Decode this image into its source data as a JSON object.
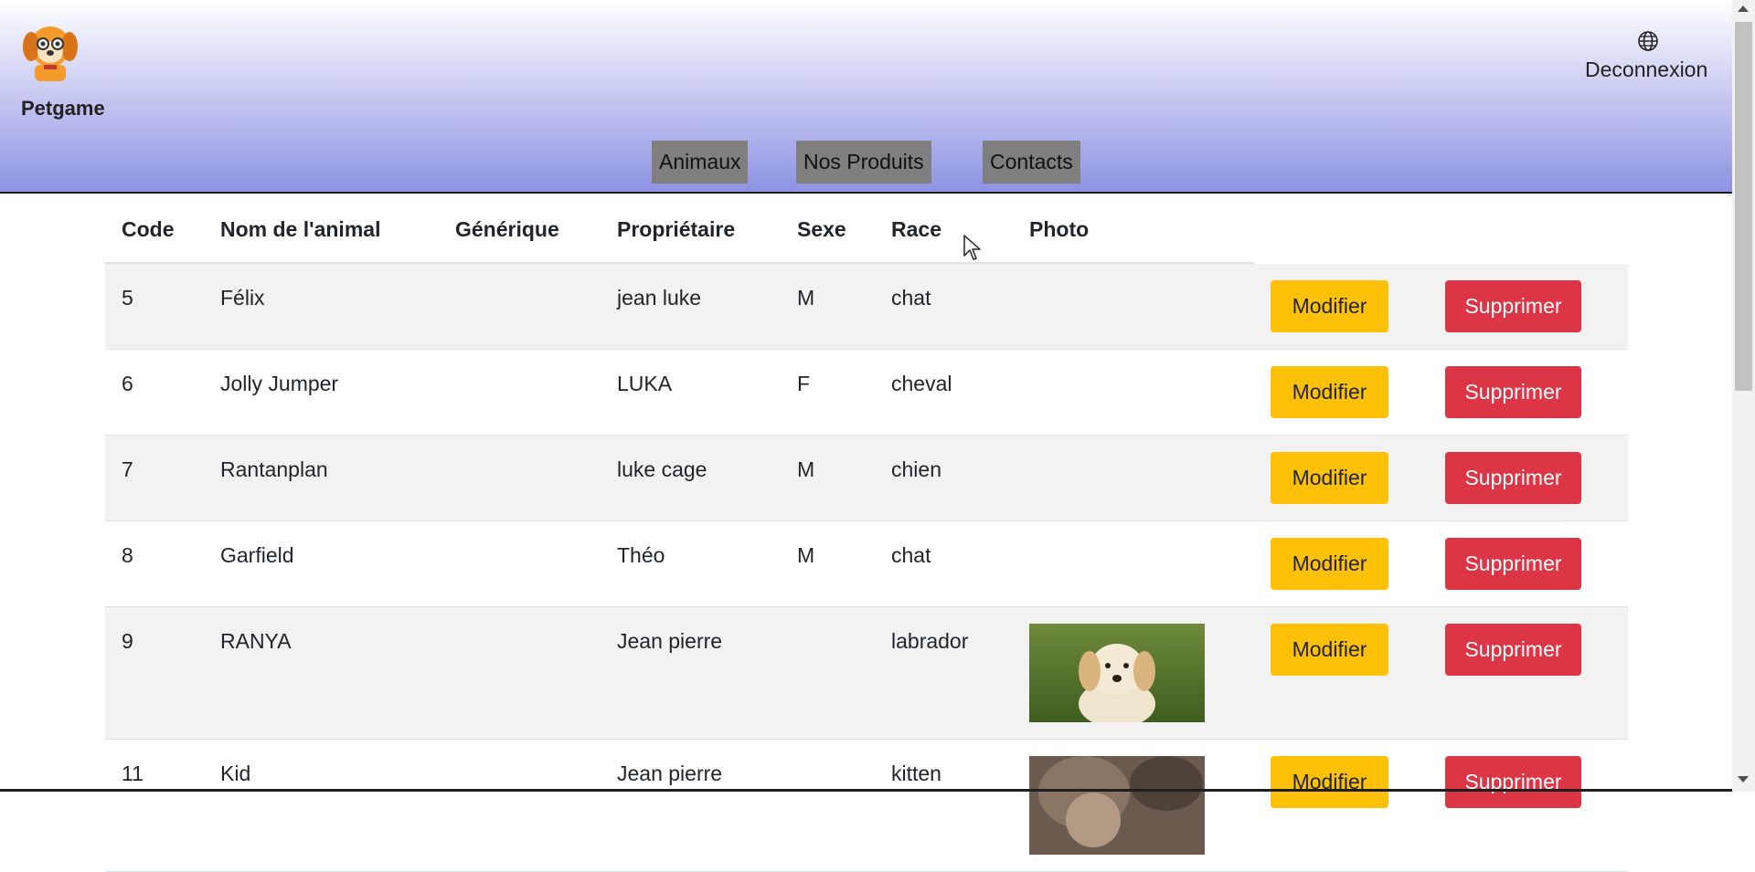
{
  "header": {
    "brand": "Petgame",
    "logout_label": "Deconnexion",
    "nav": [
      "Animaux",
      "Nos Produits",
      "Contacts"
    ],
    "gradient_colors": [
      "#ffffff",
      "#8e92e3"
    ],
    "icons": {
      "logo": "dog-logo-icon",
      "language": "globe-icon"
    }
  },
  "table": {
    "headers": [
      "Code",
      "Nom de l'animal",
      "Générique",
      "Propriétaire",
      "Sexe",
      "Race",
      "Photo"
    ],
    "rows": [
      {
        "code": "5",
        "nom": "Félix",
        "generique": "",
        "proprietaire": "jean luke",
        "sexe": "M",
        "race": "chat",
        "photo": ""
      },
      {
        "code": "6",
        "nom": "Jolly Jumper",
        "generique": "",
        "proprietaire": "LUKA",
        "sexe": "F",
        "race": "cheval",
        "photo": ""
      },
      {
        "code": "7",
        "nom": "Rantanplan",
        "generique": "",
        "proprietaire": "luke cage",
        "sexe": "M",
        "race": "chien",
        "photo": ""
      },
      {
        "code": "8",
        "nom": "Garfield",
        "generique": "",
        "proprietaire": "Théo",
        "sexe": "M",
        "race": "chat",
        "photo": ""
      },
      {
        "code": "9",
        "nom": "RANYA",
        "generique": "",
        "proprietaire": "Jean pierre",
        "sexe": "",
        "race": "labrador",
        "photo": "puppy-photo"
      },
      {
        "code": "11",
        "nom": "Kid",
        "generique": "",
        "proprietaire": "Jean pierre",
        "sexe": "",
        "race": "kitten",
        "photo": "kitten-photo"
      }
    ],
    "actions": {
      "modify": "Modifier",
      "delete": "Supprimer"
    },
    "colors": {
      "modify": "#ffc107",
      "delete": "#dc3545",
      "stripe": "#f2f2f2"
    }
  }
}
